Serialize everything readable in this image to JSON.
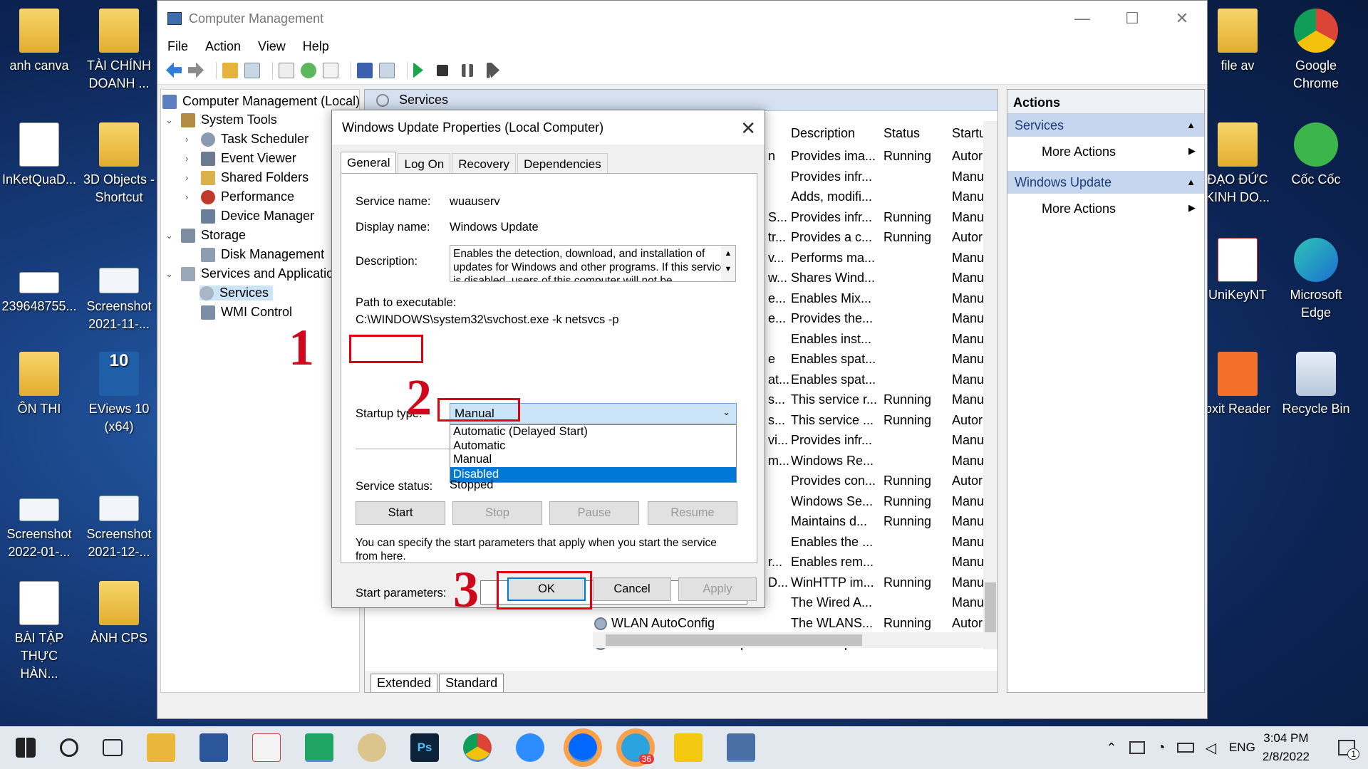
{
  "desktop_left": [
    {
      "label": "anh canva"
    },
    {
      "label": "TÀI CHÍNH DOANH ..."
    },
    {
      "label": "InKetQuaD..."
    },
    {
      "label": "3D Objects - Shortcut"
    },
    {
      "label": "239648755..."
    },
    {
      "label": "Screenshot 2021-11-..."
    },
    {
      "label": "ÔN THI"
    },
    {
      "label": "EViews 10 (x64)"
    },
    {
      "label": "Screenshot 2022-01-..."
    },
    {
      "label": "Screenshot 2021-12-..."
    },
    {
      "label": "BÀI TẬP THỰC HÀN..."
    },
    {
      "label": "ẢNH CPS"
    }
  ],
  "desktop_right": [
    {
      "label": "file av"
    },
    {
      "label": "Google Chrome"
    },
    {
      "label": "ĐẠO ĐỨC KINH DO..."
    },
    {
      "label": "Cốc Cốc"
    },
    {
      "label": "UniKeyNT"
    },
    {
      "label": "Microsoft Edge"
    },
    {
      "label": "oxit Reader"
    },
    {
      "label": "Recycle Bin"
    }
  ],
  "window": {
    "title": "Computer Management",
    "menu": [
      "File",
      "Action",
      "View",
      "Help"
    ]
  },
  "tree": {
    "root": "Computer Management (Local)",
    "system_tools": "System Tools",
    "task_scheduler": "Task Scheduler",
    "event_viewer": "Event Viewer",
    "shared_folders": "Shared Folders",
    "performance": "Performance",
    "device_manager": "Device Manager",
    "storage": "Storage",
    "disk_management": "Disk Management",
    "services_apps": "Services and Applicatio",
    "services": "Services",
    "wmi": "WMI Control"
  },
  "services_panel": {
    "header": "Services",
    "columns": {
      "description": "Description",
      "status": "Status",
      "startup": "Startu"
    },
    "rows": [
      {
        "name": "",
        "prefix": "n",
        "desc": "Provides ima...",
        "status": "Running",
        "start": "Autor"
      },
      {
        "name": "",
        "prefix": "",
        "desc": "Provides infr...",
        "status": "",
        "start": "Manu"
      },
      {
        "name": "",
        "prefix": "",
        "desc": "Adds, modifi...",
        "status": "",
        "start": "Manu"
      },
      {
        "name": "",
        "prefix": "S...",
        "desc": "Provides infr...",
        "status": "Running",
        "start": "Manu"
      },
      {
        "name": "",
        "prefix": "tr...",
        "desc": "Provides a c...",
        "status": "Running",
        "start": "Autor"
      },
      {
        "name": "",
        "prefix": "v...",
        "desc": "Performs ma...",
        "status": "",
        "start": "Manu"
      },
      {
        "name": "",
        "prefix": "w...",
        "desc": "Shares Wind...",
        "status": "",
        "start": "Manu"
      },
      {
        "name": "",
        "prefix": "e...",
        "desc": "Enables Mix...",
        "status": "",
        "start": "Manu"
      },
      {
        "name": "",
        "prefix": "e...",
        "desc": "Provides the...",
        "status": "",
        "start": "Manu"
      },
      {
        "name": "",
        "prefix": "",
        "desc": "Enables inst...",
        "status": "",
        "start": "Manu"
      },
      {
        "name": "",
        "prefix": "e",
        "desc": "Enables spat...",
        "status": "",
        "start": "Manu"
      },
      {
        "name": "",
        "prefix": "at...",
        "desc": "Enables spat...",
        "status": "",
        "start": "Manu"
      },
      {
        "name": "",
        "prefix": "s...",
        "desc": "This service r...",
        "status": "Running",
        "start": "Manu"
      },
      {
        "name": "",
        "prefix": "s...",
        "desc": "This service ...",
        "status": "Running",
        "start": "Autor"
      },
      {
        "name": "",
        "prefix": "vi...",
        "desc": "Provides infr...",
        "status": "",
        "start": "Manu"
      },
      {
        "name": "",
        "prefix": "m...",
        "desc": "Windows Re...",
        "status": "",
        "start": "Manu"
      },
      {
        "name": "",
        "prefix": "",
        "desc": "Provides con...",
        "status": "Running",
        "start": "Autor"
      },
      {
        "name": "",
        "prefix": "",
        "desc": "Windows Se...",
        "status": "Running",
        "start": "Manu"
      },
      {
        "name": "",
        "prefix": "",
        "desc": "Maintains d...",
        "status": "Running",
        "start": "Manu"
      },
      {
        "name": "",
        "prefix": "",
        "desc": "Enables the ...",
        "status": "",
        "start": "Manu"
      },
      {
        "name": "",
        "prefix": "r...",
        "desc": "Enables rem...",
        "status": "",
        "start": "Manu"
      },
      {
        "name": "",
        "prefix": "D...",
        "desc": "WinHTTP im...",
        "status": "Running",
        "start": "Manu"
      },
      {
        "name": "",
        "prefix": "",
        "desc": "The Wired A...",
        "status": "",
        "start": "Manu"
      },
      {
        "name": "WLAN AutoConfig",
        "prefix": "",
        "desc": "The WLANS...",
        "status": "Running",
        "start": "Autor"
      },
      {
        "name": "WMI Performance Adapter",
        "prefix": "",
        "desc": "Provides per...",
        "status": "",
        "start": "Manu"
      }
    ],
    "tabs": [
      "Extended",
      "Standard"
    ]
  },
  "actions": {
    "title": "Actions",
    "section1": "Services",
    "item1": "More Actions",
    "section2": "Windows Update",
    "item2": "More Actions"
  },
  "dialog": {
    "title": "Windows Update Properties (Local Computer)",
    "tabs": [
      "General",
      "Log On",
      "Recovery",
      "Dependencies"
    ],
    "service_name_label": "Service name:",
    "service_name": "wuauserv",
    "display_name_label": "Display name:",
    "display_name": "Windows Update",
    "description_label": "Description:",
    "description": "Enables the detection, download, and installation of updates for Windows and other programs. If this service is disabled, users of this computer will not be",
    "path_label": "Path to executable:",
    "path": "C:\\WINDOWS\\system32\\svchost.exe -k netsvcs -p",
    "startup_label": "Startup type:",
    "startup_value": "Manual",
    "startup_options": [
      "Automatic (Delayed Start)",
      "Automatic",
      "Manual",
      "Disabled"
    ],
    "status_label": "Service status:",
    "status_value": "Stopped",
    "buttons": {
      "start": "Start",
      "stop": "Stop",
      "pause": "Pause",
      "resume": "Resume"
    },
    "params_note": "You can specify the start parameters that apply when you start the service from here.",
    "params_label": "Start parameters:",
    "ok": "OK",
    "cancel": "Cancel",
    "apply": "Apply"
  },
  "annotations": {
    "n1": "1",
    "n2": "2",
    "n3": "3"
  },
  "taskbar": {
    "lang": "ENG",
    "time": "3:04 PM",
    "date": "2/8/2022",
    "telegram_badge": "36",
    "notif_badge": "1"
  }
}
